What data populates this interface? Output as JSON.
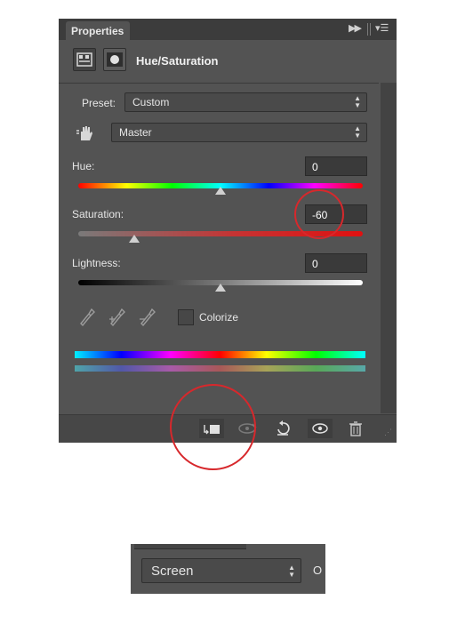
{
  "panel": {
    "tab_label": "Properties",
    "title": "Hue/Saturation",
    "preset_label": "Preset:",
    "preset_value": "Custom",
    "channel_value": "Master",
    "hue": {
      "label": "Hue:",
      "value": "0",
      "level": 0.5
    },
    "saturation": {
      "label": "Saturation:",
      "value": "-60",
      "level": 0.2
    },
    "lightness": {
      "label": "Lightness:",
      "value": "0",
      "level": 0.5
    },
    "colorize_label": "Colorize",
    "colorize_checked": false
  },
  "blend": {
    "mode_value": "Screen",
    "edge_text": "O"
  },
  "colors": {
    "panel_bg": "#535353",
    "highlight_circle": "#d7282c"
  }
}
